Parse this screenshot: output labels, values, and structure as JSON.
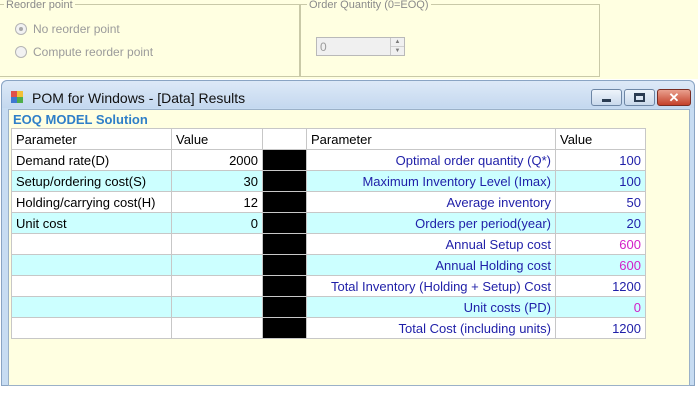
{
  "reorder_group": {
    "legend": "Reorder point",
    "options": [
      "No reorder point",
      "Compute reorder point"
    ],
    "selected_index": 0
  },
  "order_qty_group": {
    "legend": "Order Quantity (0=EOQ)",
    "value": "0"
  },
  "window": {
    "title": "POM for Windows - [Data] Results"
  },
  "solution": {
    "title": "EOQ MODEL Solution",
    "headers": {
      "left_param": "Parameter",
      "left_value": "Value",
      "right_param": "Parameter",
      "right_value": "Value"
    },
    "inputs": [
      {
        "label": "Demand rate(D)",
        "value": "2000"
      },
      {
        "label": "Setup/ordering cost(S)",
        "value": "30"
      },
      {
        "label": "Holding/carrying cost(H)",
        "value": "12"
      },
      {
        "label": "Unit cost",
        "value": "0"
      },
      {
        "label": "",
        "value": ""
      },
      {
        "label": "",
        "value": ""
      },
      {
        "label": "",
        "value": ""
      },
      {
        "label": "",
        "value": ""
      },
      {
        "label": "",
        "value": ""
      }
    ],
    "results": [
      {
        "label": "Optimal order quantity (Q*)",
        "value": "100",
        "color": "#1f1fa8"
      },
      {
        "label": "Maximum Inventory Level (Imax)",
        "value": "100",
        "color": "#1f1fa8"
      },
      {
        "label": "Average inventory",
        "value": "50",
        "color": "#1f1fa8"
      },
      {
        "label": "Orders per period(year)",
        "value": "20",
        "color": "#1f1fa8"
      },
      {
        "label": "Annual Setup cost",
        "value": "600",
        "color": "#d21fc8"
      },
      {
        "label": "Annual Holding cost",
        "value": "600",
        "color": "#d21fc8"
      },
      {
        "label": "Total Inventory (Holding + Setup) Cost",
        "value": "1200",
        "color": "#1f1fa8"
      },
      {
        "label": "Unit costs (PD)",
        "value": "0",
        "color": "#d21fc8"
      },
      {
        "label": "Total Cost (including units)",
        "value": "1200",
        "color": "#1f1fa8"
      }
    ]
  }
}
